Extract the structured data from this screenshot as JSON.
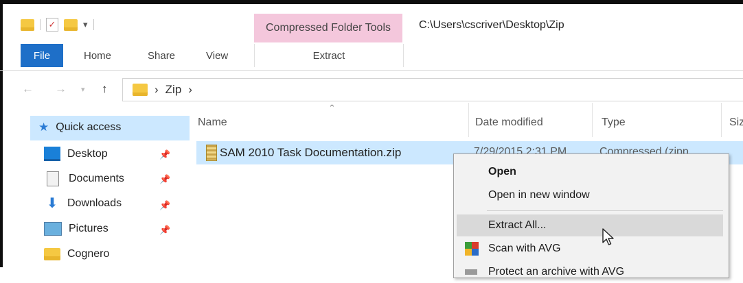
{
  "titlebar": {
    "context_tab_header": "Compressed Folder Tools",
    "path": "C:\\Users\\cscriver\\Desktop\\Zip"
  },
  "ribbon": {
    "tabs": [
      "File",
      "Home",
      "Share",
      "View",
      "Extract"
    ]
  },
  "address_bar": {
    "crumbs": [
      "Zip"
    ]
  },
  "nav_pane": {
    "quick_access": "Quick access",
    "items": [
      {
        "label": "Desktop",
        "icon": "desktop-icon"
      },
      {
        "label": "Documents",
        "icon": "documents-icon"
      },
      {
        "label": "Downloads",
        "icon": "downloads-icon"
      },
      {
        "label": "Pictures",
        "icon": "pictures-icon"
      },
      {
        "label": "Cognero",
        "icon": "folder-icon"
      }
    ]
  },
  "file_list": {
    "columns": [
      "Name",
      "Date modified",
      "Type",
      "Siz"
    ],
    "rows": [
      {
        "name": "SAM 2010 Task Documentation.zip",
        "date": "7/29/2015 2:31 PM",
        "type": "Compressed (zipp"
      }
    ]
  },
  "context_menu": {
    "items": [
      "Open",
      "Open in new window",
      "Extract All...",
      "Scan with AVG"
    ],
    "partial_item": "Protect an archive with AVG"
  },
  "colors": {
    "file_tab": "#1e6fc8",
    "context_tab": "#f4c7dc",
    "selection": "#cce8ff"
  }
}
